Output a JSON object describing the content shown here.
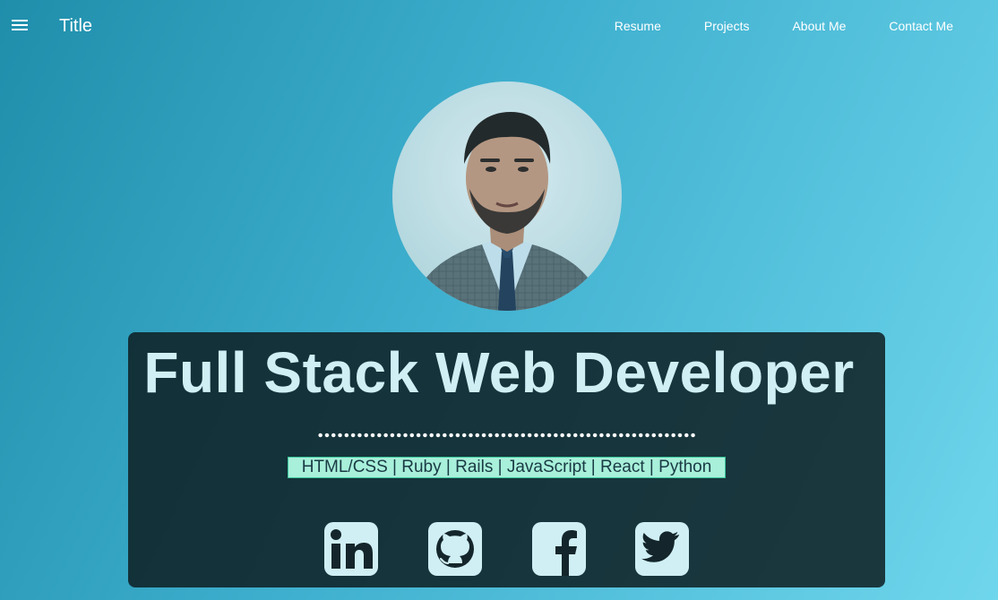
{
  "header": {
    "title": "Title",
    "nav": [
      "Resume",
      "Projects",
      "About Me",
      "Contact Me"
    ]
  },
  "hero": {
    "headline": "Full Stack Web Developer",
    "skills": "HTML/CSS | Ruby | Rails | JavaScript | React | Python"
  },
  "social": [
    "linkedin-icon",
    "github-icon",
    "facebook-icon",
    "twitter-icon"
  ],
  "colors": {
    "background_start": "#1f8eab",
    "background_end": "#6fd6ec",
    "panel": "#0e1e22",
    "headline": "#cfeff5",
    "skills_highlight": "#a8f0da"
  }
}
